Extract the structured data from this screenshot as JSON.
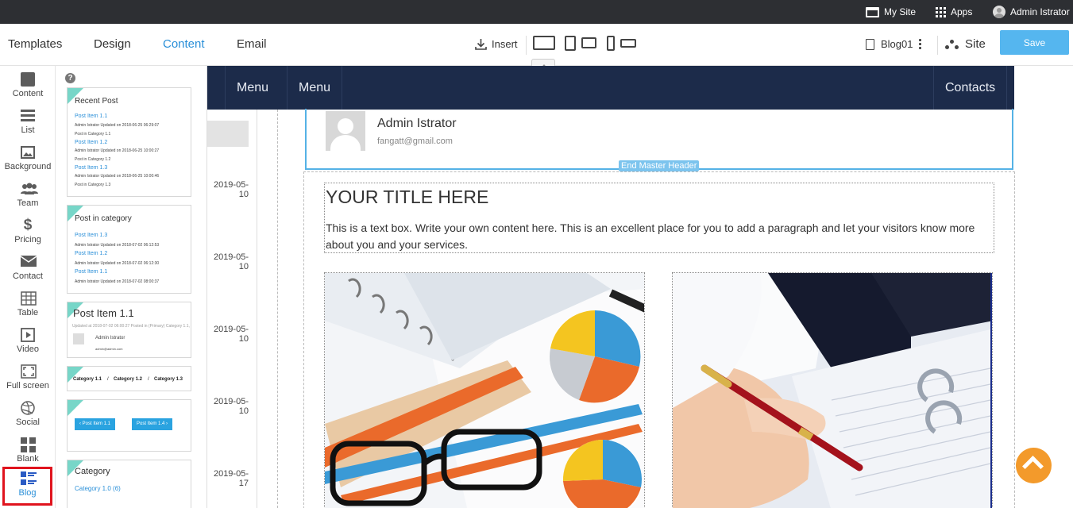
{
  "adminbar": {
    "my_site": "My Site",
    "apps": "Apps",
    "user": "Admin Istrator"
  },
  "toolbar": {
    "tabs": [
      "Templates",
      "Design",
      "Content",
      "Email"
    ],
    "active_tab": "Content",
    "insert_label": "Insert",
    "page_name": "Blog01",
    "site_label": "Site",
    "save_label": "Save",
    "accent": "#2a8fd8",
    "save_color": "#55b6ef"
  },
  "rail": {
    "items": [
      "Content",
      "List",
      "Background",
      "Team",
      "Pricing",
      "Contact",
      "Table",
      "Video",
      "Full screen",
      "Social",
      "Blank",
      "Blog"
    ],
    "selected": "Blog"
  },
  "panel": {
    "help": "?",
    "recent_post": {
      "title": "Recent Post",
      "items": [
        {
          "link": "Post Item 1.1",
          "meta1": "Admin Istrator Updated on 2018-06-25 06:29:07",
          "meta2": "Post in Category 1.1"
        },
        {
          "link": "Post Item 1.2",
          "meta1": "Admin Istrator Updated on 2018-06-25 10:00:27",
          "meta2": "Post in Category 1.2"
        },
        {
          "link": "Post Item 1.3",
          "meta1": "Admin Istrator Updated on 2018-06-25 10:00:46",
          "meta2": "Post in Category 1.3"
        }
      ]
    },
    "post_in_category": {
      "title": "Post in category",
      "items": [
        {
          "link": "Post Item 1.3",
          "meta": "Admin Istrator Updated on 2018-07-02 06:12:53"
        },
        {
          "link": "Post Item 1.2",
          "meta": "Admin Istrator Updated on 2018-07-02 06:12:30"
        },
        {
          "link": "Post Item 1.1",
          "meta": "Admin Istrator Updated on 2018-07-02 08:00:37"
        }
      ]
    },
    "post_item": {
      "title": "Post Item 1.1",
      "meta": "Updated at 2018-07-02 06:00:27 Posted in (Primary) Category 1.1,",
      "author": "Admin Istrator",
      "email": "admin@admin.com"
    },
    "breadcrumb": {
      "items": [
        "Category 1.1",
        "Category 1.2",
        "Category 1.3"
      ],
      "sep": "/"
    },
    "pager": {
      "prev": "‹ Post Item 1.1",
      "next": "Post Item 1.4 ›"
    },
    "category": {
      "title": "Category",
      "items": [
        "Category 1.0 (6)"
      ]
    }
  },
  "canvas": {
    "nav": [
      "Menu",
      "Menu"
    ],
    "nav_right": "Contacts",
    "nav_color": "#1c2b4a",
    "dates": [
      "2019-05-10",
      "2019-05-10",
      "2019-05-10",
      "2019-05-10",
      "2019-05-17"
    ],
    "author": "Admin Istrator",
    "email": "fangatt@gmail.com",
    "end_master": "End Master Header",
    "title": "YOUR TITLE HERE",
    "body": "This is a text box. Write your own content here. This is an excellent place for you to add a paragraph and let your visitors know more about you and your services.",
    "scroll_color": "#f39a2b"
  }
}
